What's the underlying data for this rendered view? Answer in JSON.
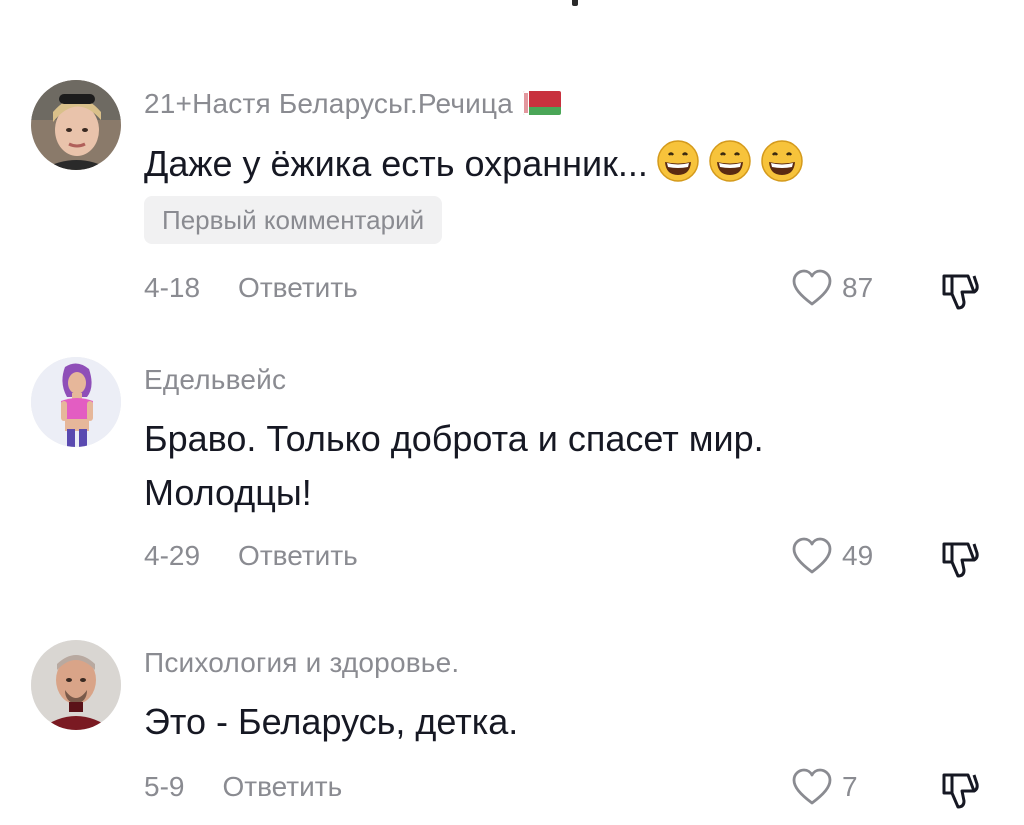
{
  "comments": [
    {
      "username": "21+Настя Беларусьг.Речица",
      "text_lines": [
        "Даже у ёжика есть охранник..."
      ],
      "emojis": [
        "grinning-face-icon",
        "grinning-face-icon",
        "grinning-face-icon"
      ],
      "badge": "Первый комментарий",
      "date": "4-18",
      "reply_label": "Ответить",
      "likes": "87"
    },
    {
      "username": "Едельвейс",
      "text_lines": [
        "Браво. Только доброта и спасет мир.",
        "Молодцы!"
      ],
      "date": "4-29",
      "reply_label": "Ответить",
      "likes": "49"
    },
    {
      "username": "Психология и здоровье.",
      "text_lines": [
        "Это - Беларусь, детка."
      ],
      "date": "5-9",
      "reply_label": "Ответить",
      "likes": "7"
    }
  ],
  "colors": {
    "text_primary": "#161823",
    "text_secondary": "#8a8b91",
    "badge_bg": "#f1f1f2",
    "emoji_yellow": "#f7c33b"
  }
}
